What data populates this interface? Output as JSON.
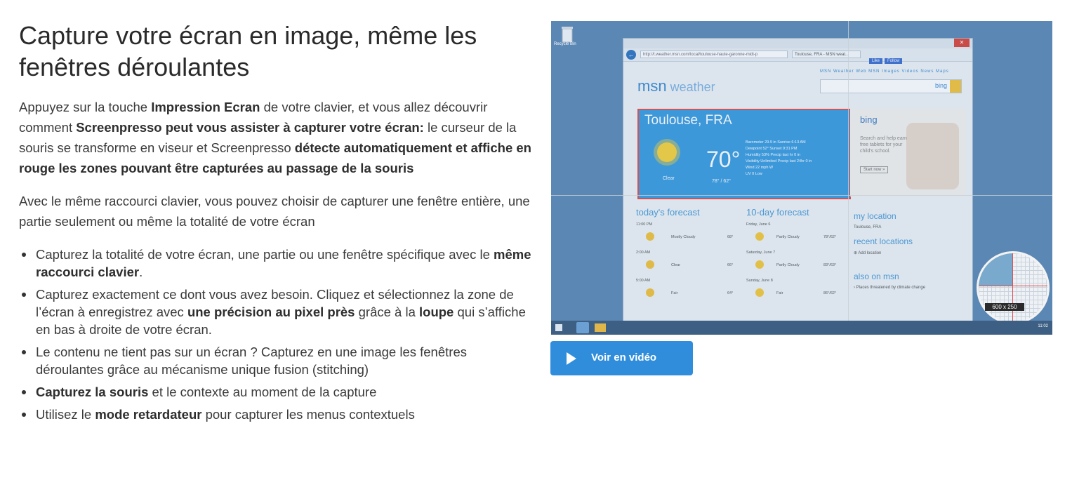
{
  "heading": "Capture votre écran en image, même les fenêtres déroulantes",
  "p1": {
    "t1": "Appuyez sur la touche ",
    "b1": "Impression Ecran",
    "t2": " de votre clavier, et vous allez découvrir comment ",
    "b2": "Screenpresso peut vous assister à capturer votre écran:",
    "t3": " le curseur de la souris se transforme en viseur et Screenpresso ",
    "b3": "détecte automatiquement et affiche en rouge les zones pouvant être capturées au passage de la souris"
  },
  "p2": "Avec le même raccourci clavier, vous pouvez choisir de capturer une fenêtre entière, une partie seulement ou même la totalité de votre écran",
  "bullets": [
    {
      "a": "Capturez la totalité de votre écran, une partie ou une fenêtre spécifique avec le ",
      "b": "même raccourci clavier",
      "c": "."
    },
    {
      "a": "Capturez exactement ce dont vous avez besoin. Cliquez et sélectionnez la zone de l’écran à enregistrez avec ",
      "b": "une précision au pixel près",
      "c": " grâce à la ",
      "d": "loupe",
      "e": " qui s’affiche en bas à droite de votre écran."
    },
    {
      "a": "Le contenu ne tient pas sur un écran ? Capturez en une image les fenêtres déroulantes grâce au mécanisme unique fusion (stitching)"
    },
    {
      "b": "Capturez la souris",
      "a": " et le contexte au moment de la capture"
    },
    {
      "a": "Utilisez le ",
      "b": "mode retardateur",
      "c": " pour capturer les menus contextuels"
    }
  ],
  "video_button": "Voir en vidéo",
  "screenshot": {
    "recycle_label": "Recycle Bin",
    "url": "http://t.weather.msn.com/local/toulouse-haute-garonne-midi-p",
    "tab": "Toulouse, FRA - MSN weat...",
    "social_like": "Like",
    "social_follow": "Follow",
    "nav": "MSN Weather   Web   MSN   Images   Videos   News   Maps",
    "logo_msn": "msn",
    "logo_weather": " weather",
    "bing": "bing",
    "city": "Toulouse, FRA",
    "temp": "70°",
    "condition": "Clear",
    "hilo": "78° / 62°",
    "details": "Barometer 29.9 in   Sunrise 6:13 AM\nDewpoint 52°   Sunset 9:31 PM\nHumidity 53%   Precip last hr 0 in\nVisibility Unlimited   Precip last 24hr 0 in\nWind 22 mph W\nUV 0 Low",
    "ad_bing": "bing",
    "ad_text": "Search and help earn free tablets for your child's school.",
    "ad_btn": "Start now »",
    "today": "today's forecast",
    "tenday": "10-day forecast",
    "rows": [
      {
        "time": "11:00 PM",
        "cond": "Mostly Cloudy",
        "t": "68°"
      },
      {
        "time": "2:00 AM",
        "cond": "Clear",
        "t": "66°"
      },
      {
        "time": "5:00 AM",
        "cond": "Fair",
        "t": "64°"
      }
    ],
    "days": [
      {
        "day": "Friday, June 6",
        "cond": "Partly Cloudy",
        "t": "78°/62°"
      },
      {
        "day": "Saturday, June 7",
        "cond": "Partly Cloudy",
        "t": "83°/63°"
      },
      {
        "day": "Sunday, June 8",
        "cond": "Fair",
        "t": "86°/62°"
      }
    ],
    "my_location": "my location",
    "loc_city": "Toulouse, FRA",
    "recent": "recent locations",
    "add": "⊕ Add location",
    "also": "also on msn",
    "also_item": "› Places threatened by climate change",
    "magnifier_dims": "600 x 250",
    "clock": "11:02"
  },
  "colors": {
    "button": "#2f8ddb",
    "desktop": "#5b87b5",
    "highlight": "#e24c4c"
  }
}
